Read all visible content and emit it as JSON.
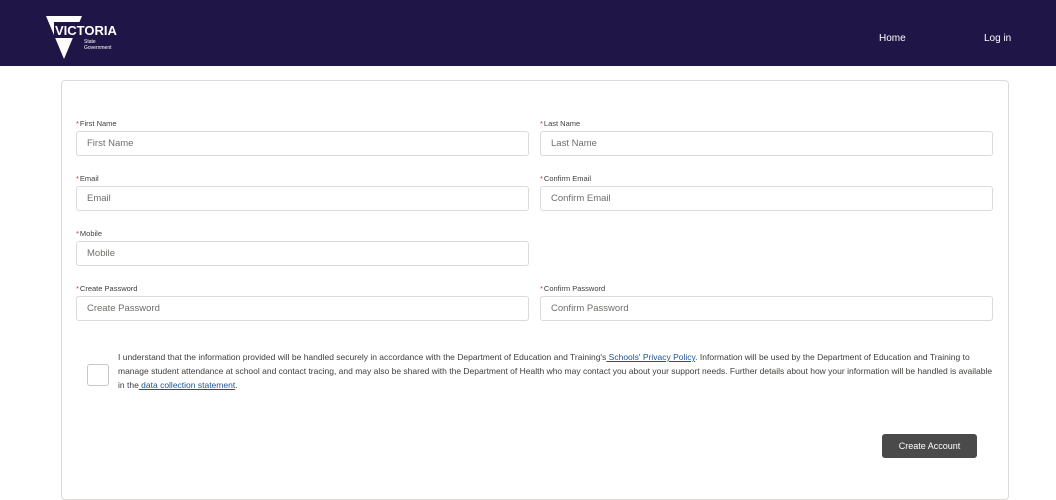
{
  "header": {
    "logo_text": "VICTORIA",
    "logo_sub1": "State",
    "logo_sub2": "Government",
    "nav": {
      "home": "Home",
      "login": "Log in"
    },
    "bg_color": "#201547"
  },
  "form": {
    "required_mark": "*",
    "first_name": {
      "label": "First Name",
      "placeholder": "First Name"
    },
    "last_name": {
      "label": "Last Name",
      "placeholder": "Last Name"
    },
    "email": {
      "label": "Email",
      "placeholder": "Email"
    },
    "confirm_email": {
      "label": "Confirm Email",
      "placeholder": "Confirm Email"
    },
    "mobile": {
      "label": "Mobile",
      "placeholder": "Mobile"
    },
    "create_password": {
      "label": "Create Password",
      "placeholder": "Create Password"
    },
    "confirm_password": {
      "label": "Confirm Password",
      "placeholder": "Confirm Password"
    },
    "consent": {
      "text_1": "I understand that the information provided will be handled securely in accordance with the Department of Education and Training's",
      "link_1": " Schools' Privacy Policy",
      "text_2": ". Information will be used by the Department of Education and Training to manage student attendance at school and contact tracing, and may also be shared with the Department of Health who may contact you about your support needs. Further details about how your information will be handled is available in the",
      "link_2": " data collection statement",
      "text_3": "."
    },
    "submit_label": "Create Account"
  }
}
